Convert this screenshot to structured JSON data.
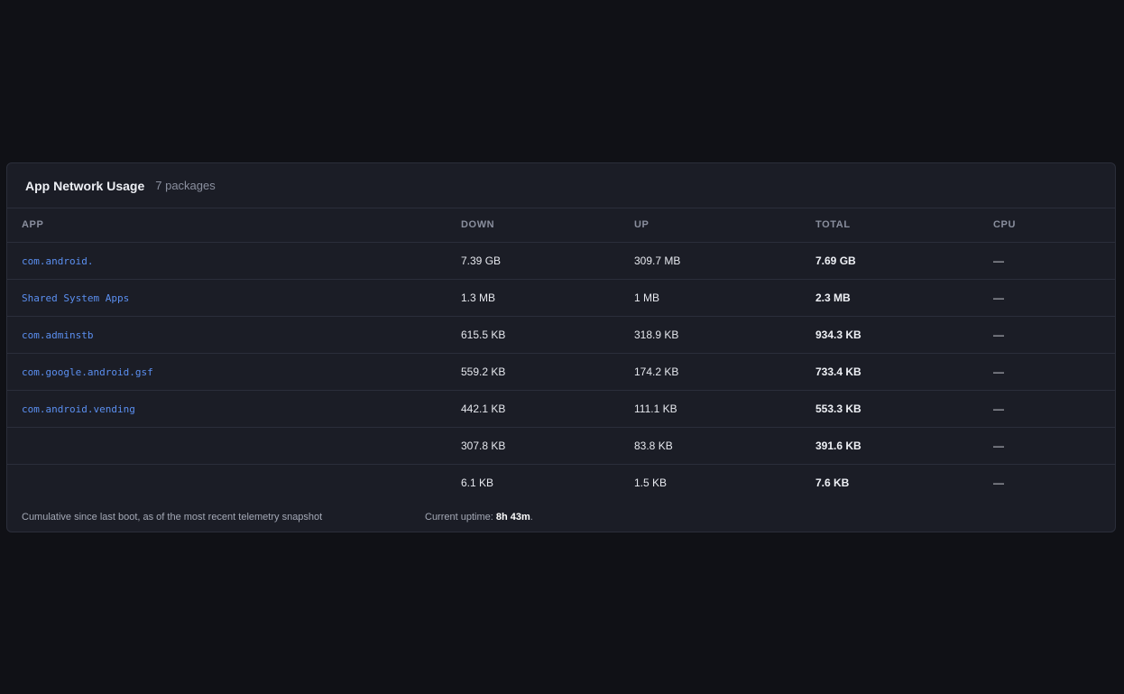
{
  "header": {
    "title": "App Network Usage",
    "count": "7 packages"
  },
  "columns": {
    "app": "APP",
    "down": "DOWN",
    "up": "UP",
    "total": "TOTAL",
    "cpu": "CPU"
  },
  "rows": [
    {
      "app": "com.android.",
      "down": "7.39 GB",
      "up": "309.7 MB",
      "total": "7.69 GB",
      "cpu": "—"
    },
    {
      "app": "Shared System Apps",
      "down": "1.3 MB",
      "up": "1 MB",
      "total": "2.3 MB",
      "cpu": "—"
    },
    {
      "app": "com.adminstb",
      "down": "615.5 KB",
      "up": "318.9 KB",
      "total": "934.3 KB",
      "cpu": "—"
    },
    {
      "app": "com.google.android.gsf",
      "down": "559.2 KB",
      "up": "174.2 KB",
      "total": "733.4 KB",
      "cpu": "—"
    },
    {
      "app": "com.android.vending",
      "down": "442.1 KB",
      "up": "111.1 KB",
      "total": "553.3 KB",
      "cpu": "—"
    },
    {
      "app": "",
      "down": "307.8 KB",
      "up": "83.8 KB",
      "total": "391.6 KB",
      "cpu": "—"
    },
    {
      "app": "",
      "down": "6.1 KB",
      "up": "1.5 KB",
      "total": "7.6 KB",
      "cpu": "—"
    }
  ],
  "footer": {
    "note": "Cumulative since last boot, as of the most recent telemetry snapshot",
    "uptime_label": "Current uptime: ",
    "uptime_value": "8h 43m",
    "uptime_suffix": "."
  },
  "colors": {
    "background": "#101116",
    "card": "#1b1d26",
    "link": "#5b8ff0"
  }
}
